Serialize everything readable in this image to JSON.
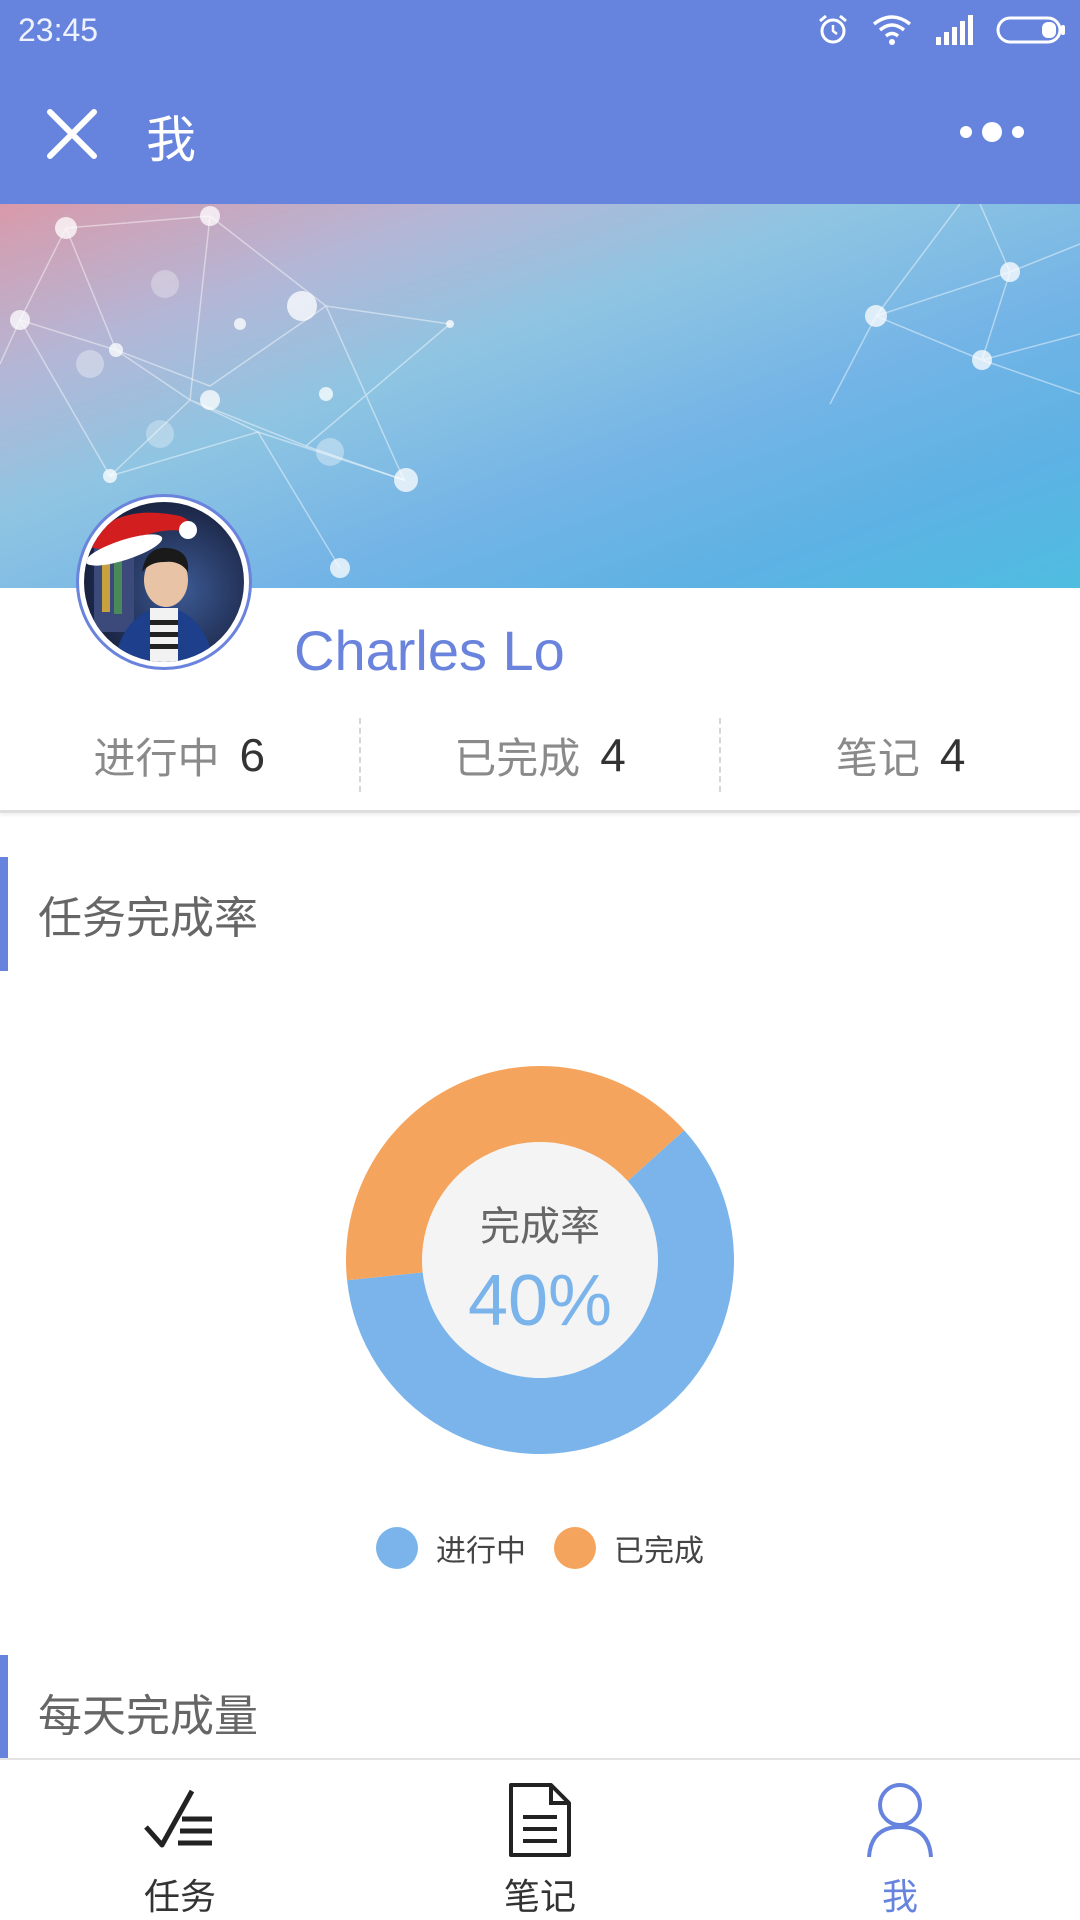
{
  "status_bar": {
    "time": "23:45",
    "icons": [
      "alarm-icon",
      "wifi-icon",
      "signal-icon",
      "battery-icon"
    ]
  },
  "header": {
    "title": "我",
    "close_icon": "close-icon",
    "more_icon": "more-icon"
  },
  "profile": {
    "name": "Charles Lo"
  },
  "stats": [
    {
      "label": "进行中",
      "value": "6"
    },
    {
      "label": "已完成",
      "value": "4"
    },
    {
      "label": "笔记",
      "value": "4"
    }
  ],
  "sections": {
    "completion_title": "任务完成率",
    "daily_title": "每天完成量"
  },
  "chart_data": {
    "type": "pie",
    "center_label": "完成率",
    "center_value": "40%",
    "slices": [
      {
        "name": "进行中",
        "value": 6,
        "color": "#7ab4ea"
      },
      {
        "name": "已完成",
        "value": 4,
        "color": "#f5a45d"
      }
    ],
    "legend_position": "bottom"
  },
  "legend": [
    {
      "label": "进行中",
      "color": "#7ab4ea"
    },
    {
      "label": "已完成",
      "color": "#f5a45d"
    }
  ],
  "bottom_nav": [
    {
      "label": "任务",
      "icon": "tasks-icon",
      "active": false
    },
    {
      "label": "笔记",
      "icon": "note-icon",
      "active": false
    },
    {
      "label": "我",
      "icon": "user-icon",
      "active": true
    }
  ],
  "colors": {
    "primary": "#6683dd",
    "in_progress": "#7ab4ea",
    "completed": "#f5a45d"
  }
}
